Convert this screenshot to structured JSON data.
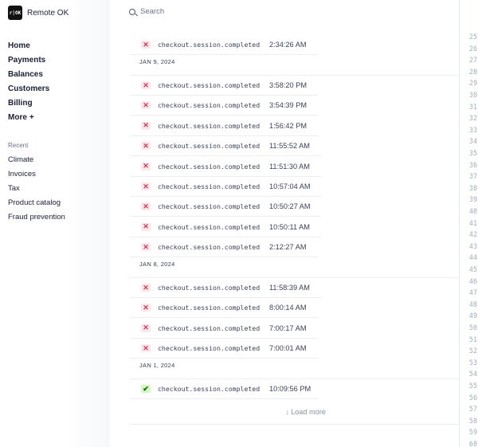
{
  "brand": {
    "logo_text": "r|OK",
    "name": "Remote OK"
  },
  "search": {
    "placeholder": "Search"
  },
  "nav": {
    "items": [
      "Home",
      "Payments",
      "Balances",
      "Customers",
      "Billing"
    ],
    "more_label": "More",
    "more_suffix": "+"
  },
  "recent": {
    "title": "Recent",
    "items": [
      "Climate",
      "Invoices",
      "Tax",
      "Product catalog",
      "Fraud prevention"
    ]
  },
  "events": {
    "top_row": {
      "status": "failed",
      "event": "checkout.session.completed",
      "time": "2:34:26 AM"
    },
    "groups": [
      {
        "date": "JAN 9, 2024",
        "rows": [
          {
            "status": "failed",
            "event": "checkout.session.completed",
            "time": "3:58:20 PM"
          },
          {
            "status": "failed",
            "event": "checkout.session.completed",
            "time": "3:54:39 PM"
          },
          {
            "status": "failed",
            "event": "checkout.session.completed",
            "time": "1:56:42 PM"
          },
          {
            "status": "failed",
            "event": "checkout.session.completed",
            "time": "11:55:52 AM"
          },
          {
            "status": "failed",
            "event": "checkout.session.completed",
            "time": "11:51:30 AM"
          },
          {
            "status": "failed",
            "event": "checkout.session.completed",
            "time": "10:57:04 AM"
          },
          {
            "status": "failed",
            "event": "checkout.session.completed",
            "time": "10:50:27 AM"
          },
          {
            "status": "failed",
            "event": "checkout.session.completed",
            "time": "10:50:11 AM"
          },
          {
            "status": "failed",
            "event": "checkout.session.completed",
            "time": "2:12:27 AM"
          }
        ]
      },
      {
        "date": "JAN 8, 2024",
        "rows": [
          {
            "status": "failed",
            "event": "checkout.session.completed",
            "time": "11:58:39 AM"
          },
          {
            "status": "failed",
            "event": "checkout.session.completed",
            "time": "8:00:14 AM"
          },
          {
            "status": "failed",
            "event": "checkout.session.completed",
            "time": "7:00:17 AM"
          },
          {
            "status": "failed",
            "event": "checkout.session.completed",
            "time": "7:00:01 AM"
          }
        ]
      },
      {
        "date": "JAN 1, 2024",
        "rows": [
          {
            "status": "succeeded",
            "event": "checkout.session.completed",
            "time": "10:09:56 PM"
          }
        ]
      }
    ],
    "load_more": "Load more"
  },
  "icons": {
    "failed": "x-icon",
    "succeeded": "check-icon",
    "load_more": "arrow-down-icon"
  },
  "colors": {
    "failed_bg": "#fde8ec",
    "failed_fg": "#d1365a",
    "ok_bg": "#d7f7c2",
    "ok_fg": "#05690d"
  },
  "line_numbers": [
    "25",
    "26",
    "27",
    "28",
    "29",
    "30",
    "31",
    "32",
    "33",
    "34",
    "35",
    "36",
    "37",
    "38",
    "39",
    "40",
    "41",
    "42",
    "43",
    "44",
    "45",
    "46",
    "47",
    "48",
    "49",
    "50",
    "51",
    "52",
    "53",
    "54",
    "55",
    "56",
    "57",
    "58",
    "59",
    "60"
  ]
}
